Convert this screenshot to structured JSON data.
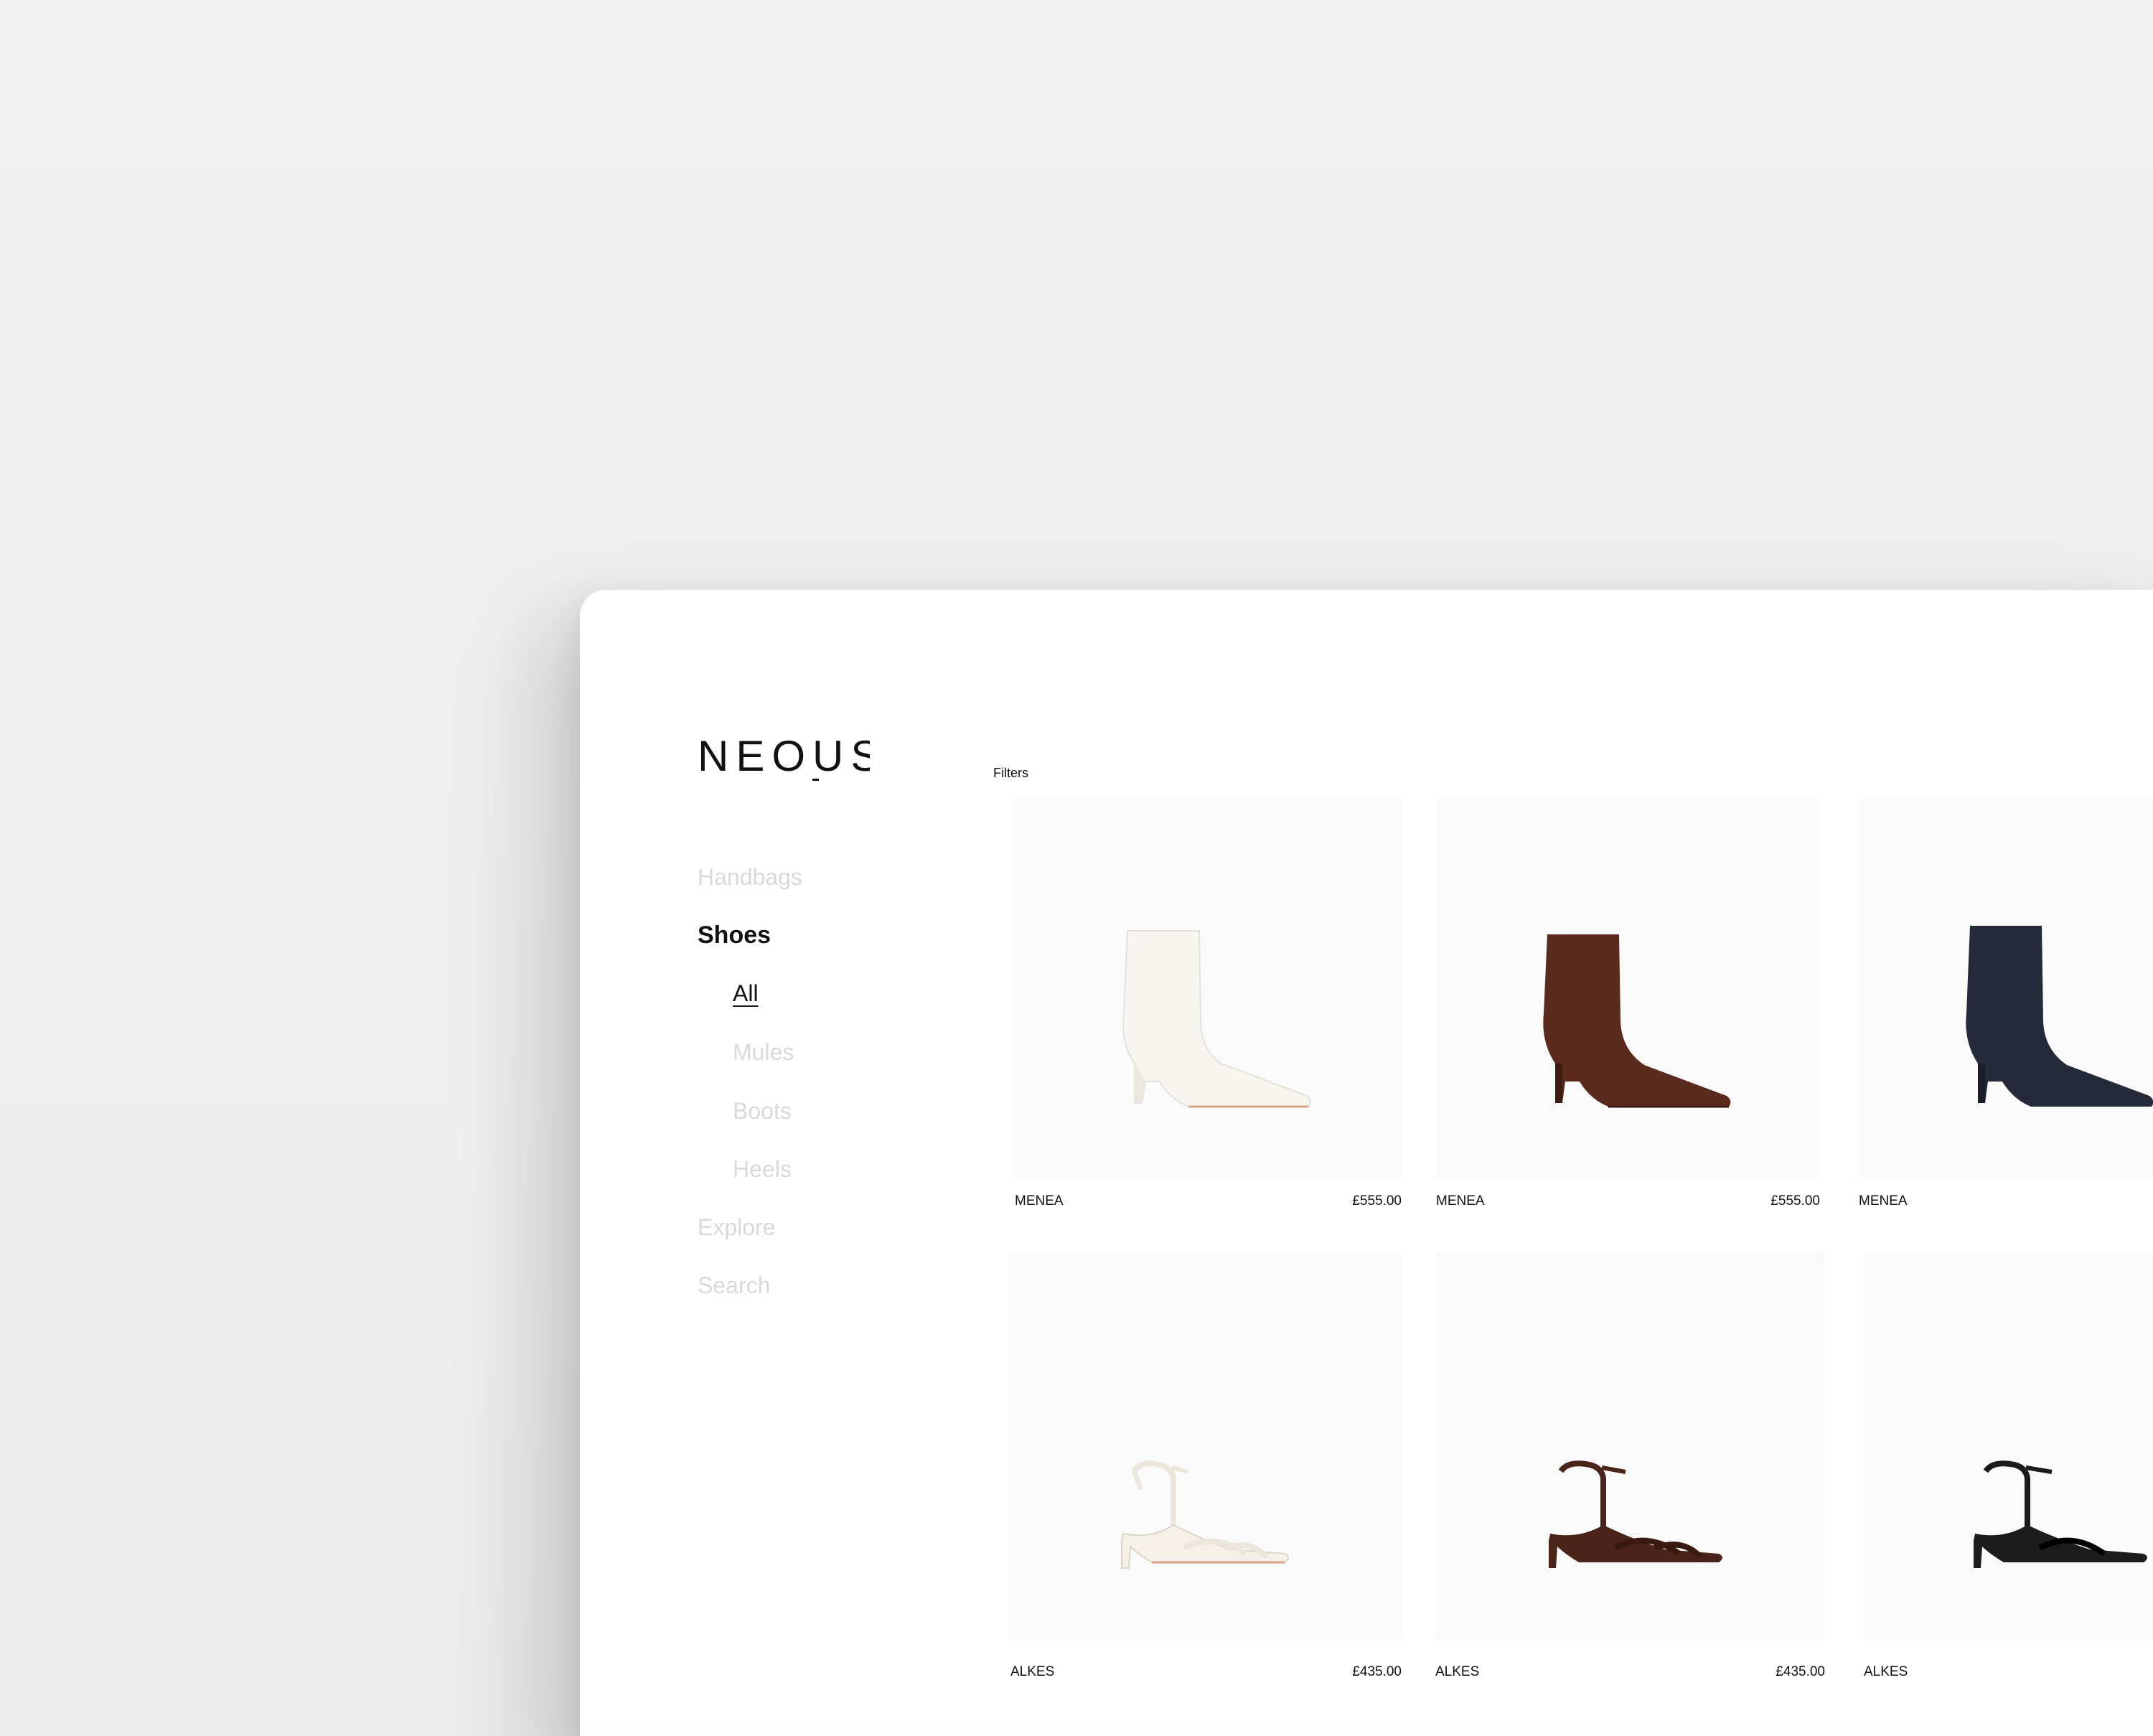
{
  "brand": {
    "logo_text": "NEOUS"
  },
  "sidebar": {
    "items": [
      {
        "label": "Handbags",
        "state": "inactive"
      },
      {
        "label": "Shoes",
        "state": "active"
      },
      {
        "label": "All",
        "state": "current-sub"
      },
      {
        "label": "Mules",
        "state": "inactive-sub"
      },
      {
        "label": "Boots",
        "state": "inactive-sub"
      },
      {
        "label": "Heels",
        "state": "inactive-sub"
      },
      {
        "label": "Explore",
        "state": "inactive"
      },
      {
        "label": "Search",
        "state": "inactive"
      }
    ]
  },
  "toolbar": {
    "filters_label": "Filters"
  },
  "products": [
    {
      "name": "MENEA",
      "price": "£555.00",
      "image": "white-ankle-boot"
    },
    {
      "name": "MENEA",
      "price": "£555.00",
      "image": "brown-ankle-boot"
    },
    {
      "name": "MENEA",
      "price": "",
      "image": "navy-ankle-boot"
    },
    {
      "name": "ALKES",
      "price": "£435.00",
      "image": "cream-strappy-sandal"
    },
    {
      "name": "ALKES",
      "price": "£435.00",
      "image": "brown-strappy-sandal"
    },
    {
      "name": "ALKES",
      "price": "",
      "image": "black-strappy-sandal"
    }
  ],
  "colors": {
    "background": "#f0f0f0",
    "window": "#ffffff",
    "card_bg": "#fafafa",
    "text": "#111111",
    "nav_inactive": "#d9d9d9",
    "boot_white": "#f7f5f0",
    "boot_brown": "#5a2a1c",
    "boot_navy": "#252a3a",
    "sandal_cream": "#ece7dc",
    "sandal_brown": "#4a2418",
    "sandal_black": "#1c1c1c",
    "sole": "#e0a486"
  }
}
